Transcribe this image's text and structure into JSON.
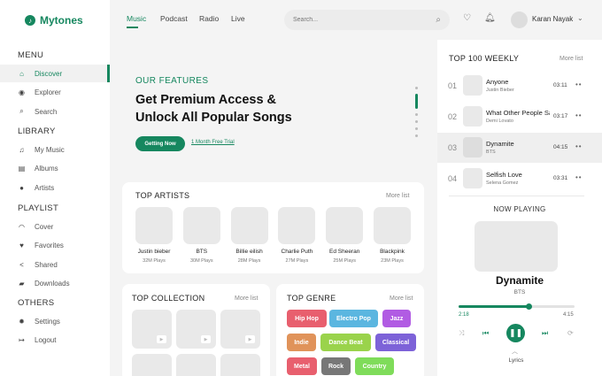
{
  "app": {
    "name": "Mytones"
  },
  "sidebar": {
    "sections": [
      {
        "title": "MENU",
        "items": [
          {
            "label": "Discover",
            "icon": "home-icon",
            "active": true
          },
          {
            "label": "Explorer",
            "icon": "compass-icon"
          },
          {
            "label": "Search",
            "icon": "search-icon"
          }
        ]
      },
      {
        "title": "LIBRARY",
        "items": [
          {
            "label": "My Music",
            "icon": "music-note-icon"
          },
          {
            "label": "Albums",
            "icon": "album-icon"
          },
          {
            "label": "Artists",
            "icon": "user-icon"
          }
        ]
      },
      {
        "title": "PLAYLIST",
        "items": [
          {
            "label": "Cover",
            "icon": "headphones-icon"
          },
          {
            "label": "Favorites",
            "icon": "heart-icon"
          },
          {
            "label": "Shared",
            "icon": "share-icon"
          },
          {
            "label": "Downloads",
            "icon": "folder-icon"
          }
        ]
      },
      {
        "title": "OTHERS",
        "items": [
          {
            "label": "Settings",
            "icon": "gear-icon"
          },
          {
            "label": "Logout",
            "icon": "logout-icon"
          }
        ]
      }
    ]
  },
  "topbar": {
    "nav": [
      "Music",
      "Podcast",
      "Radio",
      "Live"
    ],
    "active_nav": "Music",
    "search_placeholder": "Search...",
    "user_name": "Karan Nayak"
  },
  "features": {
    "subtitle": "OUR FEATURES",
    "title_line1": "Get Premium Access &",
    "title_line2": "Unlock All Popular Songs",
    "cta": "Getting Now",
    "trial": "1 Month Free Trial"
  },
  "top_artists": {
    "title": "TOP ARTISTS",
    "more": "More list",
    "items": [
      {
        "name": "Justin bieber",
        "plays": "32M Plays"
      },
      {
        "name": "BTS",
        "plays": "30M Plays"
      },
      {
        "name": "Billie eilish",
        "plays": "28M Plays"
      },
      {
        "name": "Charlie Puth",
        "plays": "27M Plays"
      },
      {
        "name": "Ed Sheeran",
        "plays": "25M Plays"
      },
      {
        "name": "Blackpink",
        "plays": "23M Plays"
      }
    ]
  },
  "top_collection": {
    "title": "TOP COLLECTION",
    "more": "More list"
  },
  "top_genre": {
    "title": "TOP GENRE",
    "more": "More list",
    "items": [
      {
        "label": "Hip Hop",
        "color": "#e85f6e"
      },
      {
        "label": "Electro Pop",
        "color": "#5bb6e0"
      },
      {
        "label": "Jazz",
        "color": "#b15ce3"
      },
      {
        "label": "Indie",
        "color": "#e0935a"
      },
      {
        "label": "Dance Beat",
        "color": "#9ad34b"
      },
      {
        "label": "Classical",
        "color": "#7d62d8"
      },
      {
        "label": "Metal",
        "color": "#e85f6e"
      },
      {
        "label": "Rock",
        "color": "#777777"
      },
      {
        "label": "Country",
        "color": "#7fdc5a"
      }
    ]
  },
  "top100": {
    "title": "TOP 100 WEEKLY",
    "more": "More list",
    "items": [
      {
        "num": "01",
        "title": "Anyone",
        "artist": "Justin Bieber",
        "duration": "03:11"
      },
      {
        "num": "02",
        "title": "What Other People Say",
        "artist": "Demi Lovato",
        "duration": "03:17"
      },
      {
        "num": "03",
        "title": "Dynamite",
        "artist": "BTS",
        "duration": "04:15",
        "active": true
      },
      {
        "num": "04",
        "title": "Selfish Love",
        "artist": "Selena Gomez",
        "duration": "03:31"
      }
    ]
  },
  "now_playing": {
    "title": "NOW PLAYING",
    "song": "Dynamite",
    "artist": "BTS",
    "current": "2:18",
    "total": "4:15",
    "progress": 0.6,
    "lyrics": "Lyrics"
  },
  "colors": {
    "accent": "#16875f"
  }
}
